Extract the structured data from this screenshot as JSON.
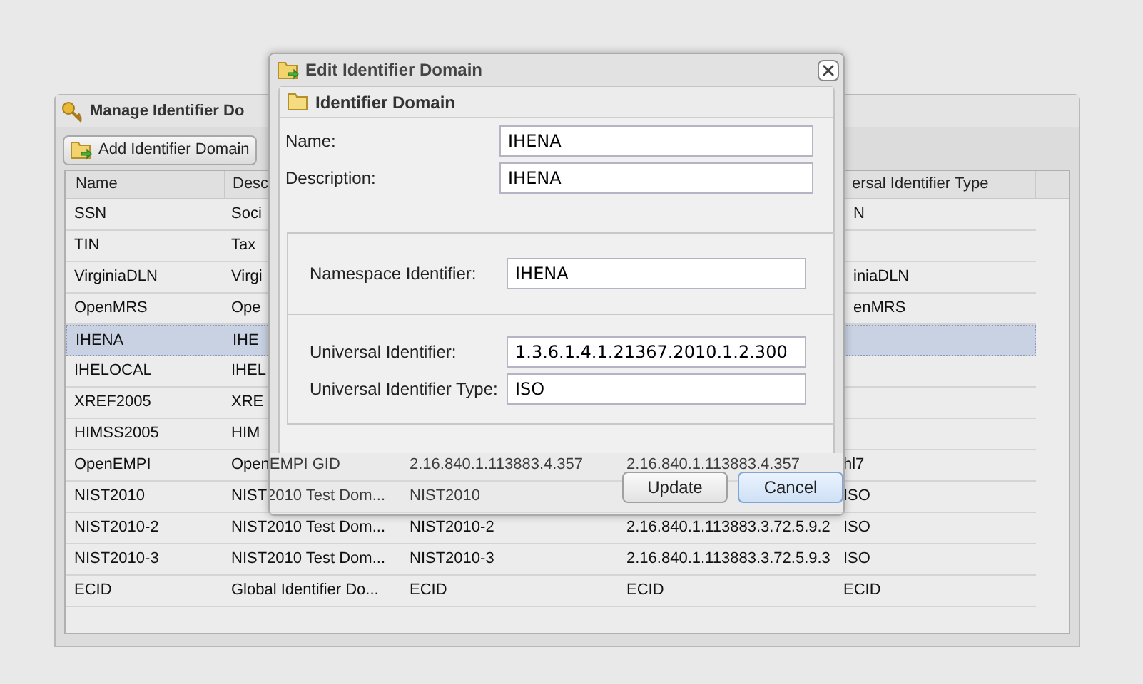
{
  "manage_panel": {
    "title": "Manage Identifier Do",
    "toolbar": [
      {
        "label": "Add Identifier Domain"
      }
    ]
  },
  "table": {
    "columns": {
      "name": "Name",
      "description": "Desc",
      "column_5": "ersal Identifier Type"
    },
    "rows": [
      {
        "name": "SSN",
        "description": "Soci",
        "column_5": "N",
        "selected": false
      },
      {
        "name": "TIN",
        "description": "Tax",
        "selected": false
      },
      {
        "name": "VirginiaDLN",
        "description": "Virgi",
        "column_5": "iniaDLN",
        "selected": false
      },
      {
        "name": "OpenMRS",
        "description": "Ope",
        "column_5": "enMRS",
        "selected": false
      },
      {
        "name": "IHENA",
        "description": "IHE",
        "selected": true
      },
      {
        "name": "IHELOCAL",
        "description": "IHEL",
        "selected": false
      },
      {
        "name": "XREF2005",
        "description": "XRE",
        "selected": false
      },
      {
        "name": "HIMSS2005",
        "description": "HIM",
        "selected": false
      },
      {
        "name": "OpenEMPI",
        "description": "OpenEMPI GID",
        "column_3": "2.16.840.1.113883.4.357",
        "column_4": "2.16.840.1.113883.4.357",
        "column_5": "hl7",
        "selected": false
      },
      {
        "name": "NIST2010",
        "description": "NIST2010 Test Dom...",
        "column_3": "NIST2010",
        "column_5": "ISO",
        "selected": false
      },
      {
        "name": "NIST2010-2",
        "description": "NIST2010 Test Dom...",
        "column_3": "NIST2010-2",
        "column_4": "2.16.840.1.113883.3.72.5.9.2",
        "column_5": "ISO",
        "selected": false
      },
      {
        "name": "NIST2010-3",
        "description": "NIST2010 Test Dom...",
        "column_3": "NIST2010-3",
        "column_4": "2.16.840.1.113883.3.72.5.9.3",
        "column_5": "ISO",
        "selected": false
      },
      {
        "name": "ECID",
        "description": "Global Identifier Do...",
        "column_3": "ECID",
        "column_4": "ECID",
        "column_5": "ECID",
        "selected": false
      }
    ]
  },
  "dialog": {
    "title": "Edit Identifier Domain",
    "form_title": "Identifier Domain",
    "fields": [
      {
        "label": "Name:",
        "value": "IHENA"
      },
      {
        "label": "Description:",
        "value": "IHENA"
      }
    ],
    "fieldsets": [
      {
        "fields": [
          {
            "label": "Namespace Identifier:",
            "value": "IHENA"
          }
        ]
      },
      {
        "fields": [
          {
            "label": "Universal Identifier:",
            "value": "1.3.6.1.4.1.21367.2010.1.2.300"
          },
          {
            "label": "Universal Identifier Type:",
            "value": "ISO"
          }
        ]
      }
    ],
    "buttons": [
      {
        "label": "Update",
        "kind": "plain"
      },
      {
        "label": "Cancel",
        "kind": "focused"
      }
    ]
  }
}
